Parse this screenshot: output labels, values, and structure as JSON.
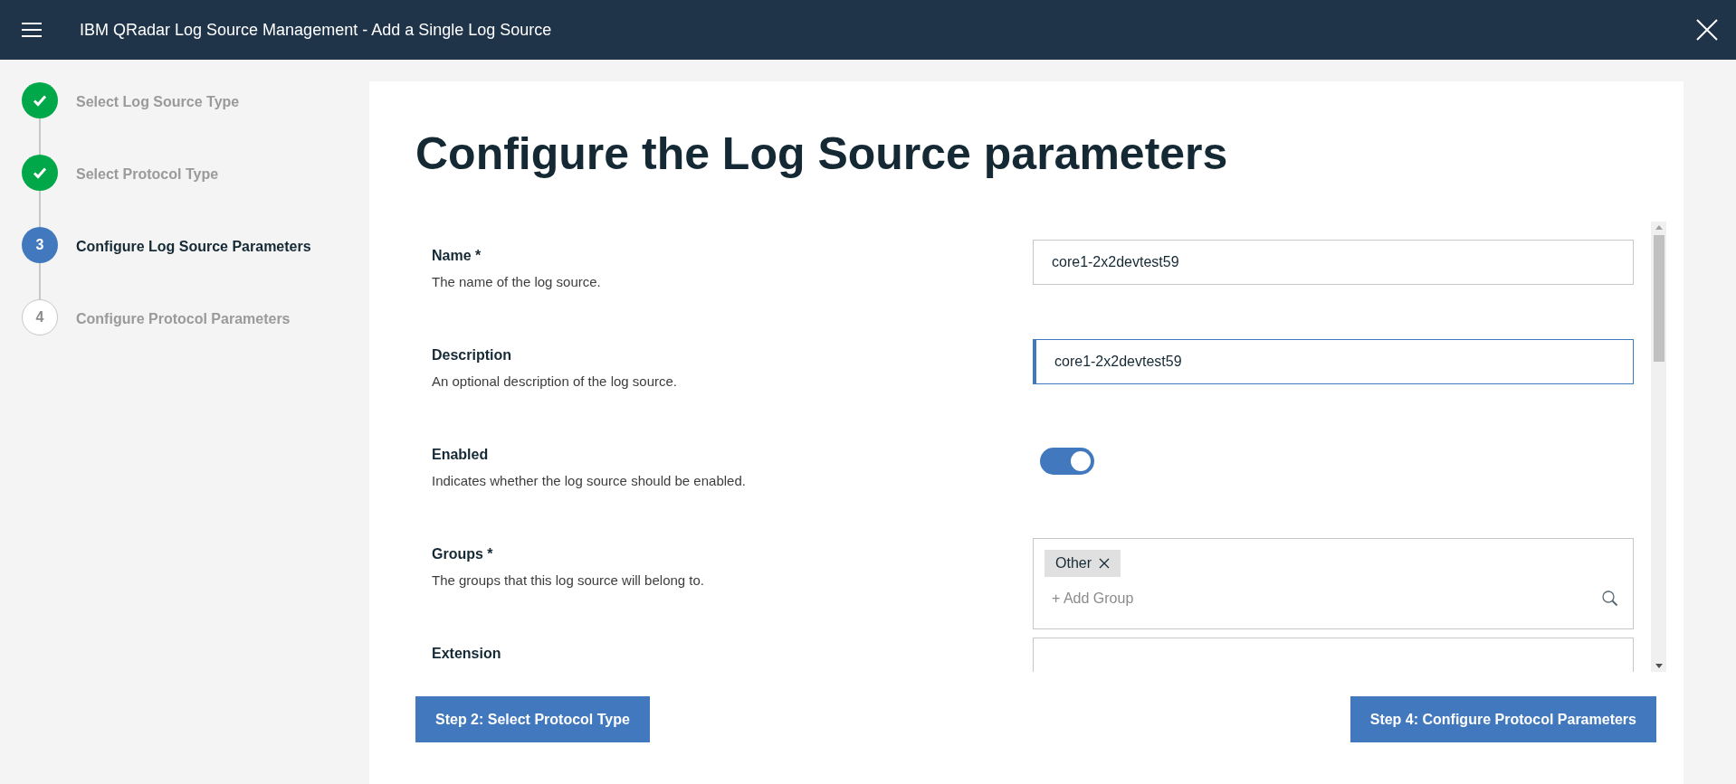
{
  "header": {
    "title": "IBM QRadar Log Source Management - Add a Single Log Source"
  },
  "steps": [
    {
      "label": "Select Log Source Type",
      "kind": "done"
    },
    {
      "label": "Select Protocol Type",
      "kind": "done"
    },
    {
      "number": "3",
      "label": "Configure Log Source Parameters",
      "kind": "current"
    },
    {
      "number": "4",
      "label": "Configure Protocol Parameters",
      "kind": "pending"
    }
  ],
  "page_title": "Configure the Log Source parameters",
  "fields": [
    {
      "kind": "text",
      "label": "Name *",
      "description": "The name of the log source.",
      "value": "core1-2x2devtest59",
      "focused": false
    },
    {
      "kind": "text",
      "label": "Description",
      "description": "An optional description of the log source.",
      "value": "core1-2x2devtest59",
      "focused": true
    },
    {
      "kind": "toggle",
      "label": "Enabled",
      "description": "Indicates whether the log source should be enabled.",
      "on": true
    },
    {
      "kind": "tags",
      "label": "Groups *",
      "description": "The groups that this log source will belong to.",
      "tags": [
        "Other"
      ],
      "placeholder": "+ Add Group"
    },
    {
      "kind": "text",
      "label": "Extension",
      "focused": false
    }
  ],
  "buttons": {
    "back": "Step 2: Select Protocol Type",
    "next": "Step 4: Configure Protocol Parameters"
  }
}
